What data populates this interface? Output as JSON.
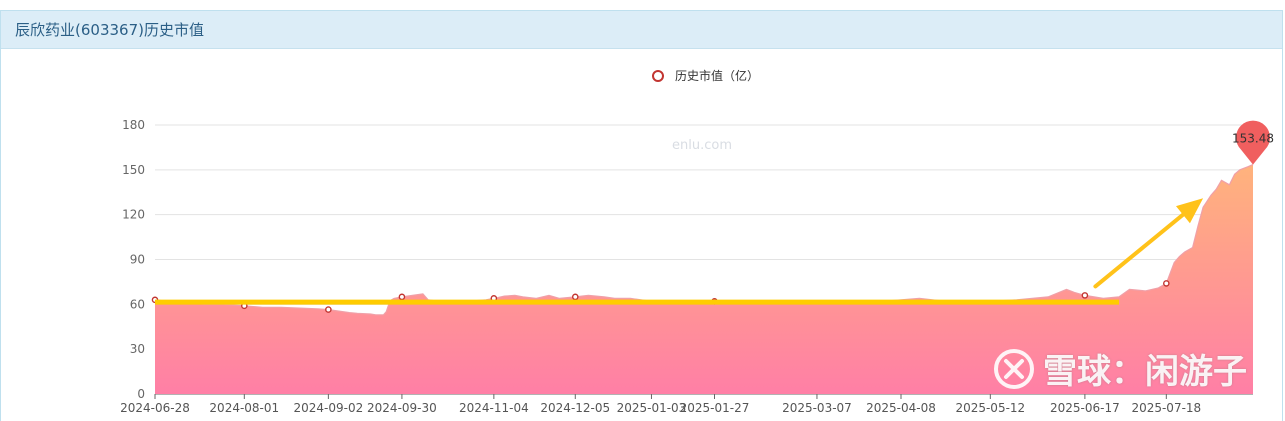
{
  "header": {
    "title": "辰欣药业(603367)历史市值"
  },
  "watermark": {
    "text": "雪球：闲游子",
    "site": "enlu.com"
  },
  "colors": {
    "area_top": "#ffb37c",
    "area_bottom": "#ff7fa6",
    "series_line": "#f0a0a8",
    "point_ring": "#c23531",
    "pin": "#f05f5f",
    "trend_line": "#ffcc00",
    "arrow": "#ffc21a"
  },
  "chart_data": {
    "type": "area",
    "legend": {
      "label": "历史市值（亿）",
      "position": "top-center",
      "icon": "ring"
    },
    "xlabel": "",
    "ylabel": "",
    "ylim": [
      0,
      180
    ],
    "yticks": [
      0,
      30,
      60,
      90,
      120,
      150,
      180
    ],
    "grid": true,
    "x_ticks": [
      "2024-06-28",
      "2024-08-01",
      "2024-09-02",
      "2024-09-30",
      "2024-11-04",
      "2024-12-05",
      "2025-01-03",
      "2025-01-27",
      "2025-03-07",
      "2025-04-08",
      "2025-05-12",
      "2025-06-17",
      "2025-07-18"
    ],
    "series": [
      {
        "name": "历史市值（亿）",
        "points": [
          [
            "2024-06-28",
            63
          ],
          [
            "2024-07-03",
            62
          ],
          [
            "2024-07-10",
            61
          ],
          [
            "2024-07-17",
            60
          ],
          [
            "2024-07-24",
            60
          ],
          [
            "2024-08-01",
            59
          ],
          [
            "2024-08-08",
            58
          ],
          [
            "2024-08-15",
            58
          ],
          [
            "2024-08-22",
            57.5
          ],
          [
            "2024-08-29",
            57
          ],
          [
            "2024-09-02",
            56.5
          ],
          [
            "2024-09-06",
            55.5
          ],
          [
            "2024-09-10",
            54.5
          ],
          [
            "2024-09-13",
            54
          ],
          [
            "2024-09-18",
            53.5
          ],
          [
            "2024-09-20",
            53
          ],
          [
            "2024-09-23",
            53
          ],
          [
            "2024-09-24",
            55
          ],
          [
            "2024-09-25",
            60
          ],
          [
            "2024-09-26",
            63
          ],
          [
            "2024-09-27",
            64
          ],
          [
            "2024-09-30",
            65
          ],
          [
            "2024-10-08",
            67
          ],
          [
            "2024-10-10",
            63
          ],
          [
            "2024-10-14",
            62
          ],
          [
            "2024-10-18",
            61
          ],
          [
            "2024-10-25",
            62
          ],
          [
            "2024-11-01",
            63
          ],
          [
            "2024-11-04",
            64
          ],
          [
            "2024-11-08",
            65.5
          ],
          [
            "2024-11-12",
            66
          ],
          [
            "2024-11-15",
            65
          ],
          [
            "2024-11-20",
            64
          ],
          [
            "2024-11-25",
            66
          ],
          [
            "2024-11-29",
            64
          ],
          [
            "2024-12-05",
            65
          ],
          [
            "2024-12-10",
            66
          ],
          [
            "2024-12-16",
            65
          ],
          [
            "2024-12-20",
            64
          ],
          [
            "2024-12-26",
            64
          ],
          [
            "2025-01-03",
            62
          ],
          [
            "2025-01-10",
            61
          ],
          [
            "2025-01-20",
            62
          ],
          [
            "2025-01-27",
            62
          ],
          [
            "2025-02-10",
            61
          ],
          [
            "2025-02-20",
            62
          ],
          [
            "2025-03-07",
            62
          ],
          [
            "2025-03-20",
            62
          ],
          [
            "2025-04-01",
            62
          ],
          [
            "2025-04-08",
            63
          ],
          [
            "2025-04-15",
            64
          ],
          [
            "2025-04-25",
            62
          ],
          [
            "2025-05-12",
            62
          ],
          [
            "2025-05-22",
            63
          ],
          [
            "2025-06-03",
            65
          ],
          [
            "2025-06-10",
            70
          ],
          [
            "2025-06-13",
            68
          ],
          [
            "2025-06-17",
            66
          ],
          [
            "2025-06-24",
            64
          ],
          [
            "2025-06-30",
            65
          ],
          [
            "2025-07-04",
            70
          ],
          [
            "2025-07-10",
            69
          ],
          [
            "2025-07-15",
            71
          ],
          [
            "2025-07-18",
            74
          ],
          [
            "2025-07-21",
            88
          ],
          [
            "2025-07-23",
            92
          ],
          [
            "2025-07-25",
            95
          ],
          [
            "2025-07-28",
            98
          ],
          [
            "2025-07-30",
            112
          ],
          [
            "2025-08-01",
            125
          ],
          [
            "2025-08-04",
            133
          ],
          [
            "2025-08-06",
            137
          ],
          [
            "2025-08-08",
            143
          ],
          [
            "2025-08-11",
            140
          ],
          [
            "2025-08-13",
            147
          ],
          [
            "2025-08-15",
            150
          ],
          [
            "2025-08-18",
            152
          ],
          [
            "2025-08-20",
            153.48
          ]
        ]
      }
    ],
    "labeled_points": [
      [
        "2024-06-28",
        63
      ],
      [
        "2024-08-01",
        59
      ],
      [
        "2024-09-02",
        56.5
      ],
      [
        "2024-09-30",
        65
      ],
      [
        "2024-11-04",
        64
      ],
      [
        "2024-12-05",
        65
      ],
      [
        "2025-01-27",
        62
      ],
      [
        "2025-06-17",
        66
      ],
      [
        "2025-07-18",
        74
      ]
    ],
    "markPoint": {
      "date": "2025-08-20",
      "value": 153.48,
      "label": "153.48",
      "style": "pin"
    },
    "annotations": [
      {
        "type": "line",
        "from": [
          "2024-06-28",
          61.5
        ],
        "to": [
          "2025-06-30",
          61.5
        ]
      },
      {
        "type": "arrow",
        "from": [
          "2025-06-21",
          72
        ],
        "to": [
          "2025-08-01",
          131
        ]
      }
    ]
  }
}
